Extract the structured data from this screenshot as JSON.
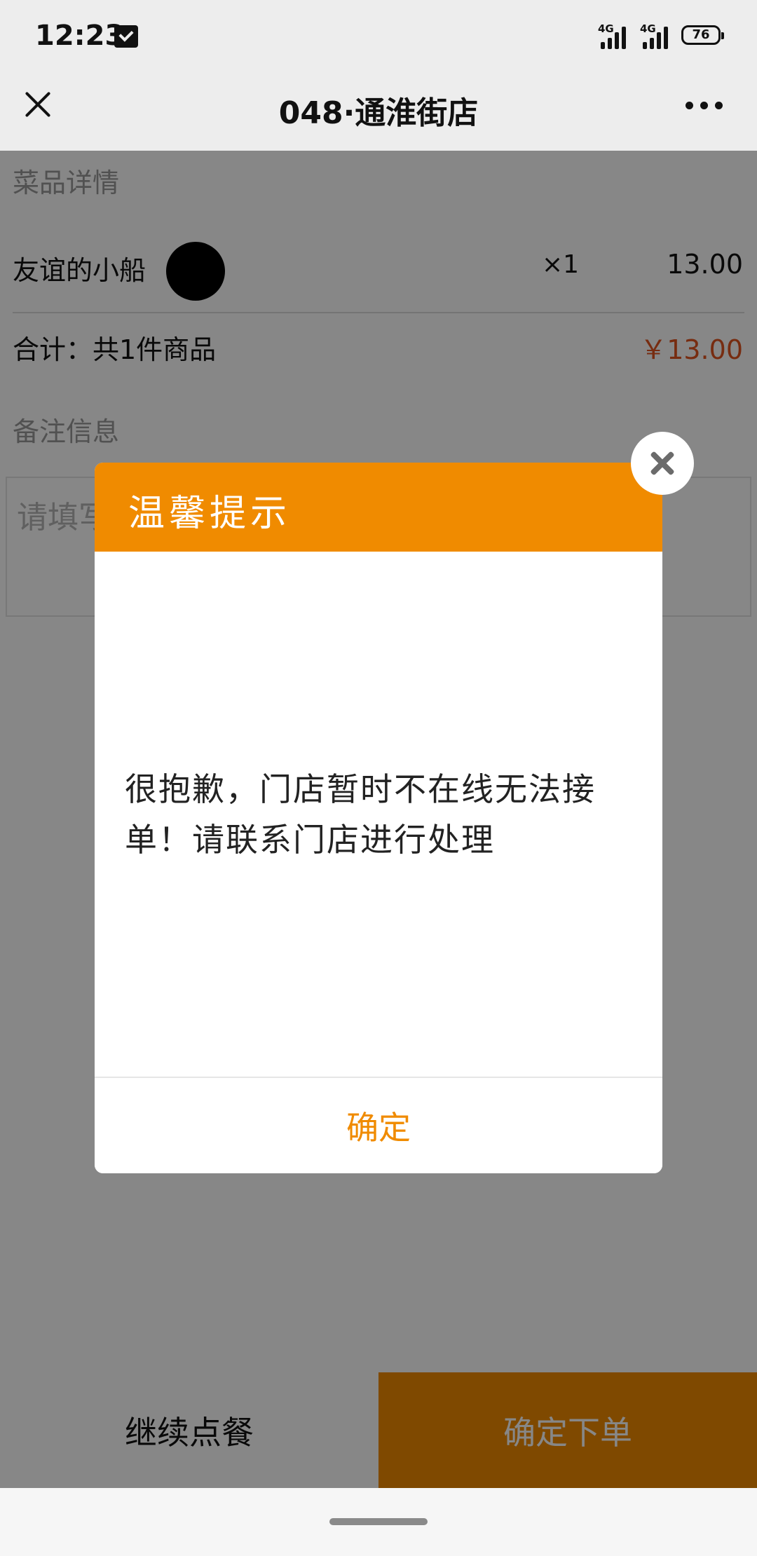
{
  "status_bar": {
    "time": "12:23",
    "network_1": "4G",
    "network_2": "4G",
    "battery": "76"
  },
  "nav": {
    "title": "048·通淮街店",
    "close_icon": "close-icon",
    "more_icon": "more-icon"
  },
  "order": {
    "section_title": "菜品详情",
    "items": [
      {
        "name": "友谊的小船",
        "qty": "×1",
        "price": "13.00"
      }
    ],
    "total_label": "合计：共1件商品",
    "total_price": "￥13.00",
    "remark_title": "备注信息",
    "remark_placeholder": "请填写"
  },
  "footer": {
    "continue_label": "继续点餐",
    "confirm_label": "确定下单"
  },
  "dialog": {
    "title": "温馨提示",
    "message": "很抱歉，门店暂时不在线无法接单！请联系门店进行处理",
    "ok_label": "确定"
  },
  "colors": {
    "accent": "#f08b00",
    "price": "#e0531f",
    "overlay": "rgba(0,0,0,0.47)"
  }
}
